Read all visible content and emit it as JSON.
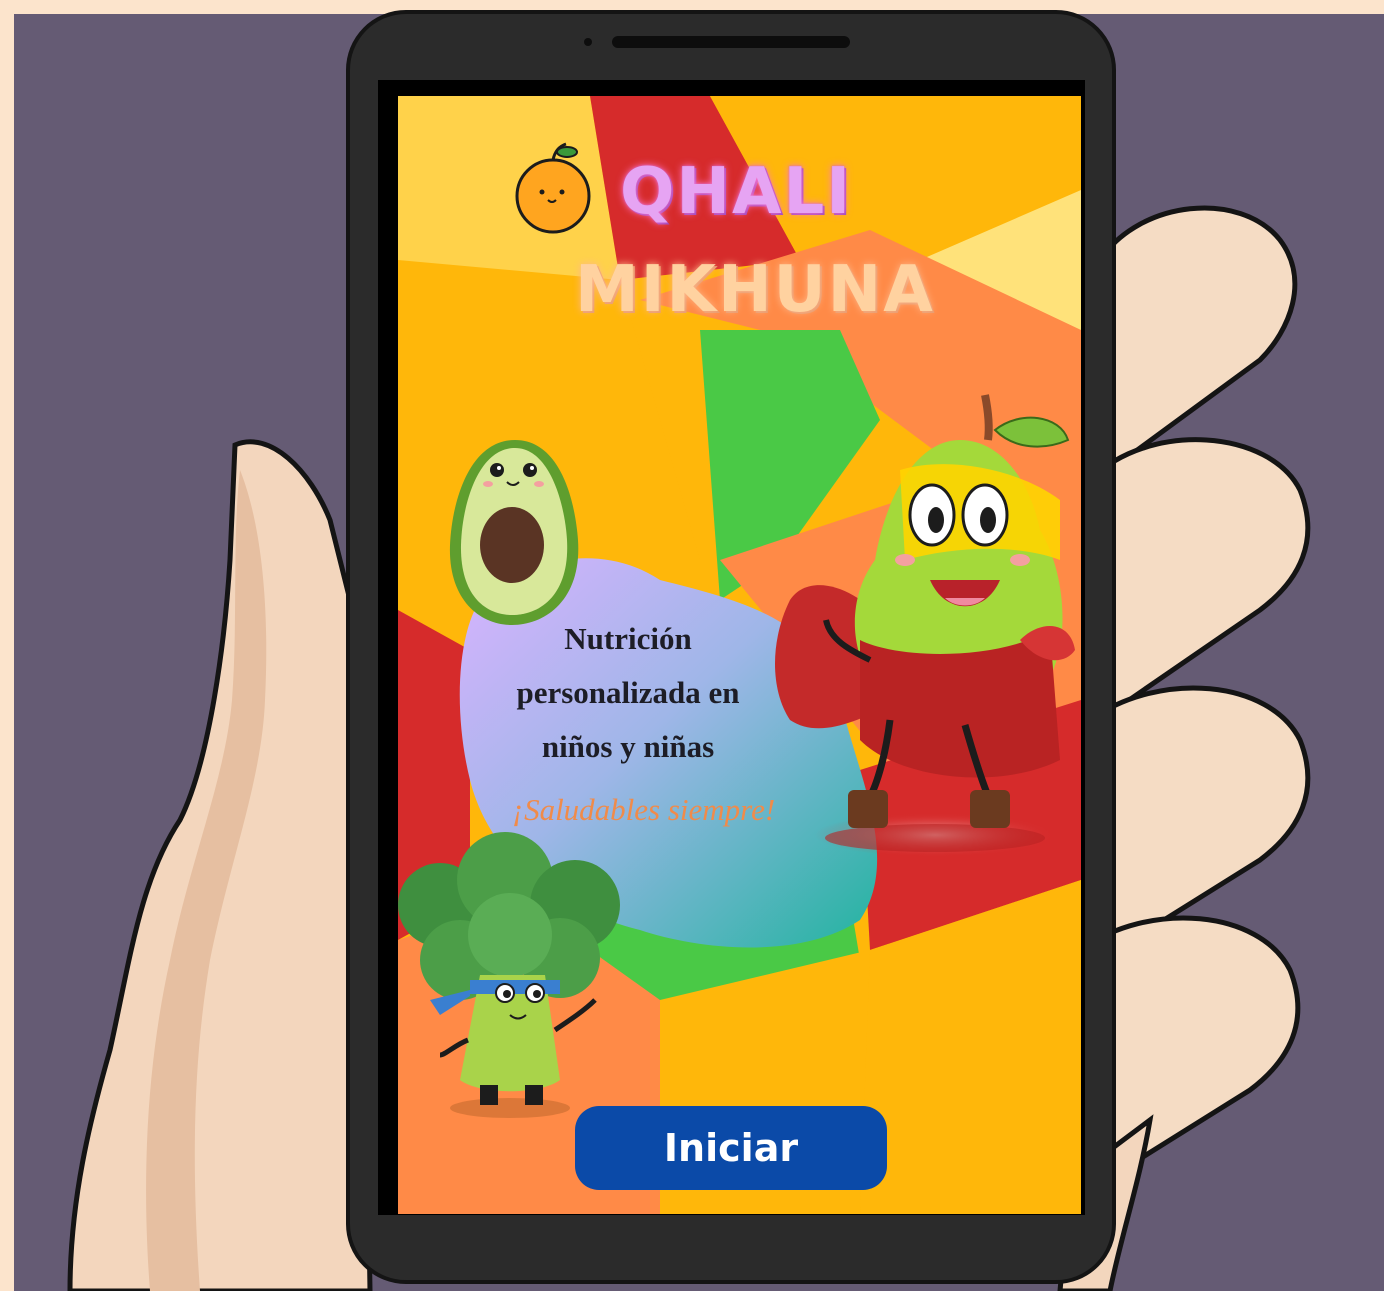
{
  "app": {
    "title_line1": "QHALI",
    "title_line2": "MIKHUNA"
  },
  "hero": {
    "tagline_line1": "Nutrición",
    "tagline_line2": "personalizada en",
    "tagline_line3": "niños y niñas",
    "slogan": "¡Saludables siempre!"
  },
  "actions": {
    "start_label": "Iniciar"
  },
  "colors": {
    "background_outer": "#fce4cc",
    "backdrop": "#655b74",
    "phone_body": "#2b2b2b",
    "screen_yellow": "#ffb70a",
    "accent_red": "#d62b2b",
    "accent_orange": "#ff8a47",
    "accent_green": "#4ac946",
    "button_blue": "#0b4aa8"
  },
  "icons": {
    "logo": "orange-fruit-icon",
    "mascots": [
      "avocado-character",
      "pear-superhero-character",
      "broccoli-ninja-character"
    ]
  }
}
